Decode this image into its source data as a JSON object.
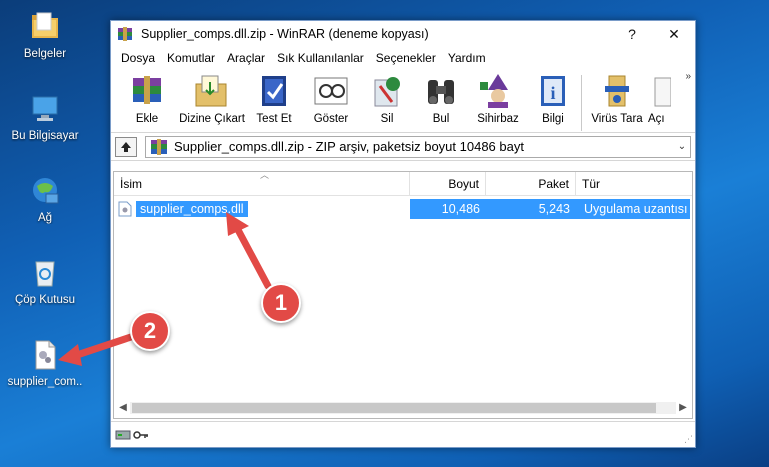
{
  "desktop": {
    "icons": [
      {
        "label": "Belgeler",
        "icon": "folder-icon"
      },
      {
        "label": "Bu Bilgisayar",
        "icon": "computer-icon"
      },
      {
        "label": "Ağ",
        "icon": "network-icon"
      },
      {
        "label": "Çöp Kutusu",
        "icon": "recycle-bin-icon"
      },
      {
        "label": "supplier_com..",
        "icon": "dll-file-icon"
      }
    ]
  },
  "window": {
    "title": "Supplier_comps.dll.zip - WinRAR (deneme kopyası)",
    "help_label": "?",
    "close_label": "✕"
  },
  "menu": {
    "items": [
      "Dosya",
      "Komutlar",
      "Araçlar",
      "Sık Kullanılanlar",
      "Seçenekler",
      "Yardım"
    ]
  },
  "toolbar": {
    "tools": [
      {
        "label": "Ekle",
        "icon": "add-archive-icon"
      },
      {
        "label": "Dizine Çıkart",
        "icon": "extract-to-icon"
      },
      {
        "label": "Test Et",
        "icon": "test-icon"
      },
      {
        "label": "Göster",
        "icon": "view-icon"
      },
      {
        "label": "Sil",
        "icon": "delete-icon"
      },
      {
        "label": "Bul",
        "icon": "find-icon"
      },
      {
        "label": "Sihirbaz",
        "icon": "wizard-icon"
      },
      {
        "label": "Bilgi",
        "icon": "info-icon"
      },
      {
        "label": "Virüs Tara",
        "icon": "virus-scan-icon"
      },
      {
        "label": "Açı",
        "icon": "comment-icon"
      }
    ],
    "overflow_label": "»"
  },
  "address": {
    "text": "Supplier_comps.dll.zip - ZIP arşiv, paketsiz boyut 10486 bayt"
  },
  "filelist": {
    "columns": [
      "İsim",
      "Boyut",
      "Paket",
      "Tür"
    ],
    "rows": [
      {
        "name": "supplier_comps.dll",
        "size": "10,486",
        "packed": "5,243",
        "type": "Uygulama uzantısı"
      }
    ]
  },
  "annotations": {
    "callout_1": "1",
    "callout_2": "2",
    "callout_color": "#e24a46"
  }
}
